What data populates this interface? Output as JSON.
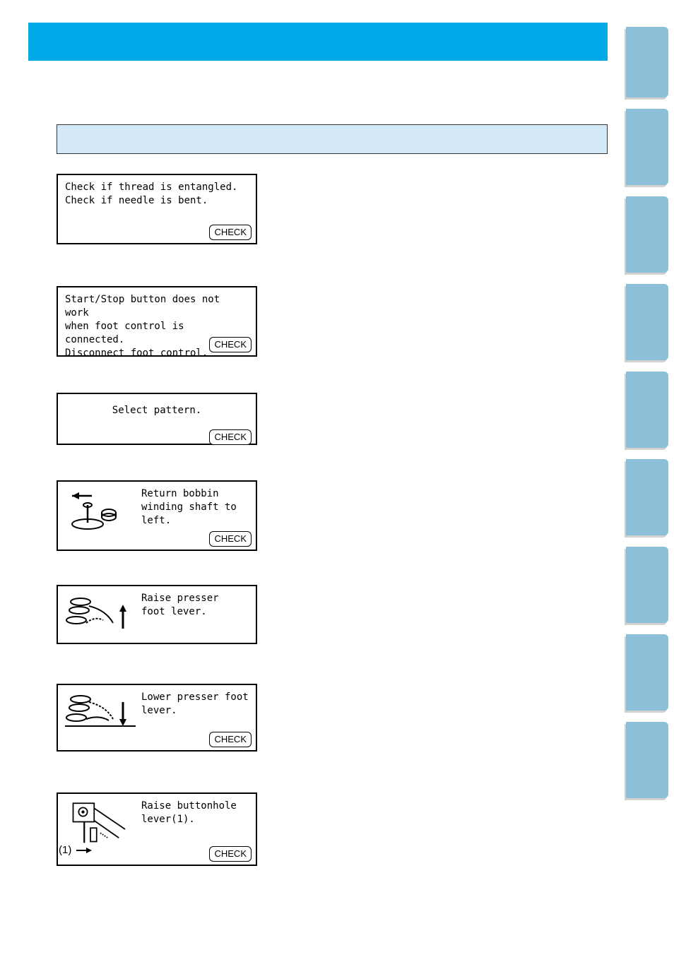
{
  "panels": {
    "p1": {
      "line1": "Check if thread is entangled.",
      "line2": "Check if needle is bent.",
      "check": "CHECK"
    },
    "p2": {
      "line1": "Start/Stop button does not work",
      "line2": "when foot control is connected.",
      "line3": "Disconnect foot control.",
      "check": "CHECK"
    },
    "p3": {
      "line1": "Select pattern.",
      "check": "CHECK"
    },
    "p4": {
      "line1": "Return bobbin",
      "line2": "winding shaft to",
      "line3": "left.",
      "check": "CHECK"
    },
    "p5": {
      "line1": "Raise presser",
      "line2": "foot lever."
    },
    "p6": {
      "line1": "Lower presser foot",
      "line2": "lever.",
      "check": "CHECK"
    },
    "p7": {
      "line1": "Raise buttonhole",
      "line2": "lever(1).",
      "check": "CHECK",
      "callout": "(1)"
    }
  }
}
